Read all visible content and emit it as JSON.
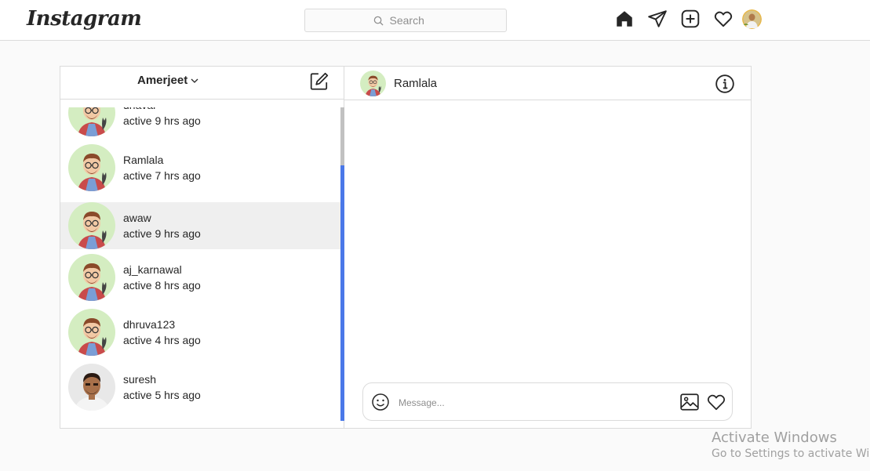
{
  "nav": {
    "logo_text": "Instagram",
    "search_placeholder": "Search",
    "icons": [
      "home-icon",
      "direct-icon",
      "new-post-icon",
      "activity-icon",
      "profile-avatar"
    ]
  },
  "inbox": {
    "account_name": "Amerjeet",
    "conversations": [
      {
        "name": "dhaval",
        "status": "active 9 hrs ago",
        "avatar": "cartoon"
      },
      {
        "name": "Ramlala",
        "status": "active 7 hrs ago",
        "avatar": "cartoon"
      },
      {
        "name": "awaw",
        "status": "active 9 hrs ago",
        "avatar": "cartoon",
        "selected": true
      },
      {
        "name": "aj_karnawal",
        "status": "active 8 hrs ago",
        "avatar": "cartoon"
      },
      {
        "name": "dhruva123",
        "status": "active 4 hrs ago",
        "avatar": "cartoon"
      },
      {
        "name": "suresh",
        "status": "active 5 hrs ago",
        "avatar": "photo"
      }
    ]
  },
  "chat": {
    "partner_name": "Ramlala",
    "message_placeholder": "Message..."
  },
  "watermark": {
    "title": "Activate Windows",
    "subtitle": "Go to Settings to activate Windows."
  },
  "colors": {
    "accent": "#4a78e8",
    "border": "#dbdbdb",
    "selected_row": "#efefef"
  }
}
